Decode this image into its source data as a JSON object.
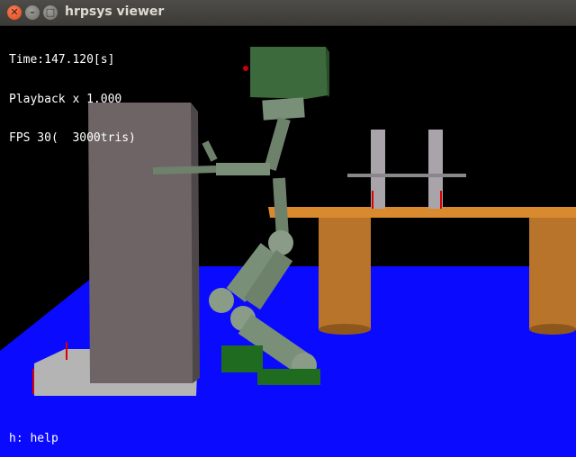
{
  "window": {
    "title": "hrpsys viewer",
    "controls": {
      "close_icon": "close-icon",
      "minimize_icon": "minimize-icon",
      "maximize_icon": "maximize-icon"
    }
  },
  "hud": {
    "time_line": "Time:147.120[s]",
    "playback_line": "Playback x 1.000",
    "fps_line": "FPS 30(  3000tris)"
  },
  "help_text": "h: help",
  "scene": {
    "colors": {
      "background": "#000000",
      "floor": "#0a0aff",
      "cabinet": "#6e6466",
      "cabinet_base": "#b4b4b4",
      "robot_head": "#3c6a3c",
      "robot_limbs": "#7a8f78",
      "robot_feet": "#1f6b1f",
      "table_top": "#d98a2e",
      "table_legs": "#c07a28",
      "table_posts": "#a8a4aa"
    }
  }
}
